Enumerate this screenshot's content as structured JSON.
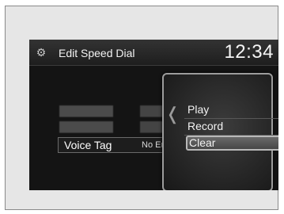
{
  "header": {
    "gear_icon": "gear-icon",
    "title": "Edit Speed Dial",
    "clock": "12:34"
  },
  "list": {
    "selected_label": "Voice Tag",
    "selected_value": "No Entry"
  },
  "popup_menu": {
    "items": [
      "Play",
      "Record",
      "Clear"
    ],
    "selected_index": 2
  }
}
